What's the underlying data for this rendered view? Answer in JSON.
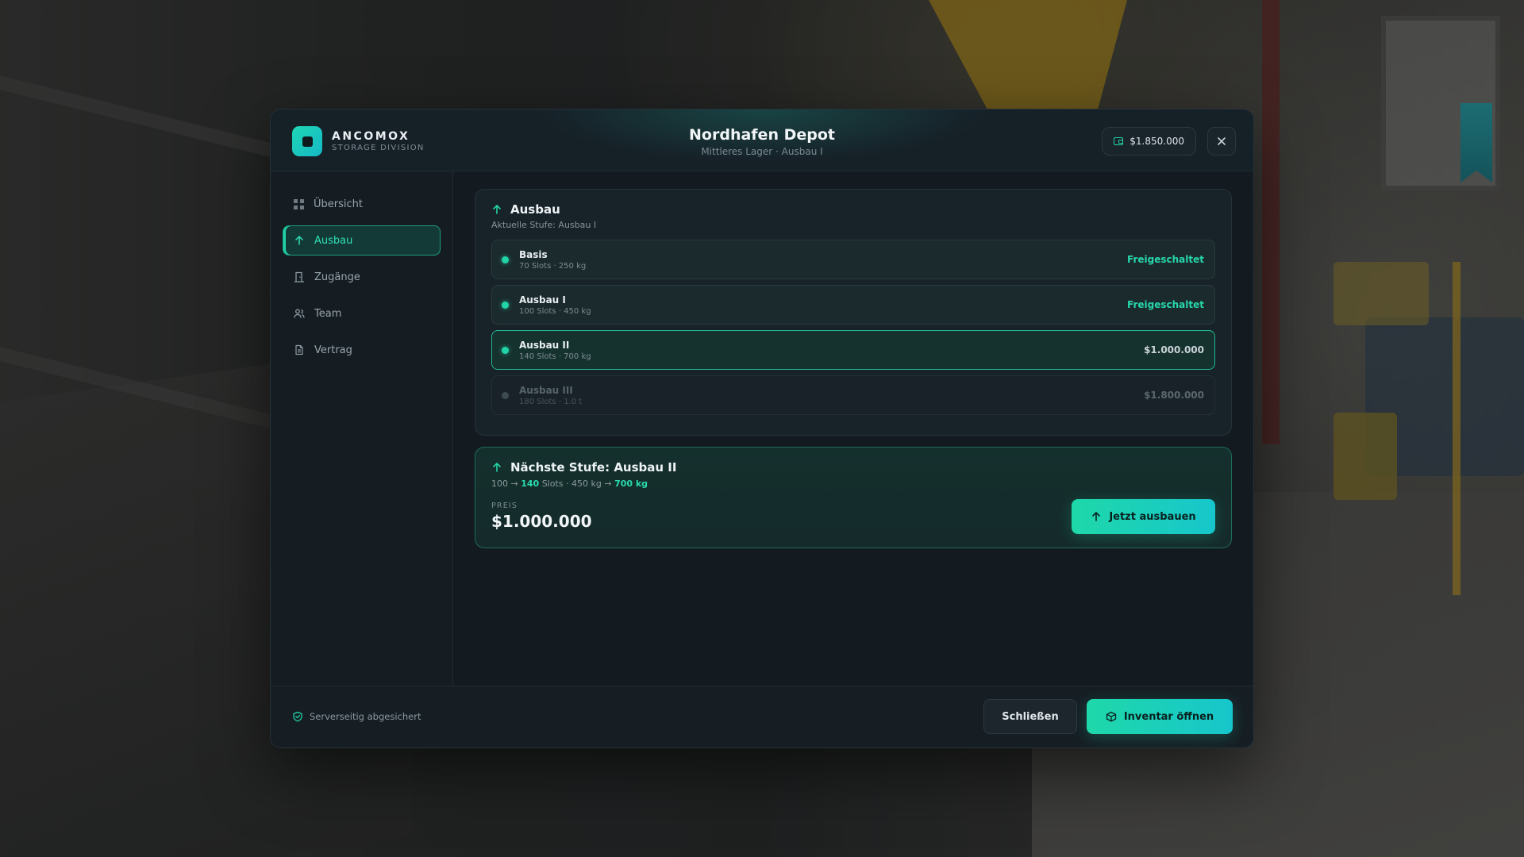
{
  "brand": {
    "name": "ANCOMOX",
    "sub": "STORAGE DIVISION"
  },
  "header": {
    "title": "Nordhafen Depot",
    "subtitle": "Mittleres Lager · Ausbau I",
    "balance": "$1.850.000"
  },
  "sidebar": {
    "items": [
      {
        "label": "Übersicht",
        "icon": "grid-icon"
      },
      {
        "label": "Ausbau",
        "icon": "arrow-up-icon",
        "active": true
      },
      {
        "label": "Zugänge",
        "icon": "door-icon"
      },
      {
        "label": "Team",
        "icon": "users-icon"
      },
      {
        "label": "Vertrag",
        "icon": "document-icon"
      }
    ]
  },
  "upgrade": {
    "title": "Ausbau",
    "current": "Aktuelle Stufe: Ausbau I",
    "tiers": [
      {
        "name": "Basis",
        "spec": "70 Slots · 250 kg",
        "status": "Freigeschaltet"
      },
      {
        "name": "Ausbau I",
        "spec": "100 Slots · 450 kg",
        "status": "Freigeschaltet"
      },
      {
        "name": "Ausbau II",
        "spec": "140 Slots · 700 kg",
        "status": "$1.000.000"
      },
      {
        "name": "Ausbau III",
        "spec": "180 Slots · 1.0 t",
        "status": "$1.800.000"
      }
    ]
  },
  "next": {
    "title": "Nächste Stufe: Ausbau II",
    "slots_from": "100",
    "slots_to": "140",
    "slots_unit": "Slots",
    "weight_from": "450 kg",
    "weight_to": "700 kg",
    "price_label": "PREIS",
    "price": "$1.000.000",
    "button": "Jetzt ausbauen"
  },
  "footer": {
    "secure": "Serverseitig abgesichert",
    "close": "Schließen",
    "inventory": "Inventar öffnen"
  },
  "colors": {
    "accent": "#22d3a7",
    "accent2": "#17c6cc",
    "panel": "#141c22"
  }
}
